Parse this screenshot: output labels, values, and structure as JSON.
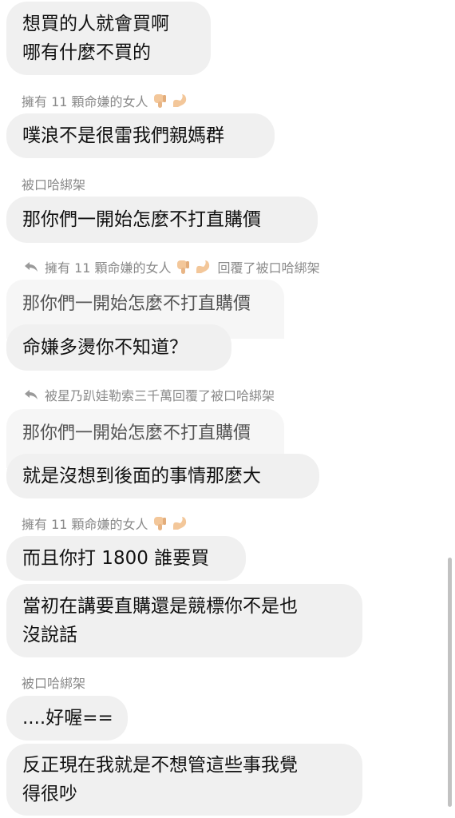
{
  "messages": {
    "m1_line1": "想買的人就會買啊",
    "m1_line2": "哪有什麼不買的",
    "sender_a_1": "擁有 11 顆命嫌的女人",
    "m2": "噗浪不是很雷我們親媽群",
    "sender_b_1": "被口哈綁架",
    "m3": "那你們一開始怎麼不打直購價",
    "reply1_from": "擁有 11 顆命嫌的女人",
    "reply1_mid": "回覆了",
    "reply1_to": "被口哈綁架",
    "quote1": "那你們一開始怎麼不打直購價",
    "m4": "命嫌多燙你不知道？",
    "reply2_text": "被星乃趴娃勒索三千萬回覆了被口哈綁架",
    "quote2": "那你們一開始怎麼不打直購價",
    "m5": "就是沒想到後面的事情那麼大",
    "sender_a_2": "擁有 11 顆命嫌的女人",
    "m6": "而且你打 1800 誰要買",
    "m7_line1": "當初在講要直購還是競標你不是也",
    "m7_line2": "沒說話",
    "sender_b_2": "被口哈綁架",
    "m8": "....好喔==",
    "m9_line1": "反正現在我就是不想管這些事我覺",
    "m9_line2": "得很吵"
  },
  "icons": {
    "emoji_1": "thumbs-down-emoji",
    "emoji_2": "flexed-biceps-emoji",
    "reply": "reply-arrow-icon"
  },
  "colors": {
    "bubble": "#f0f0f0",
    "quote_bubble": "#f6f6f6",
    "meta_text": "#8a8a8a",
    "emoji_skin": "#f3c79a"
  }
}
